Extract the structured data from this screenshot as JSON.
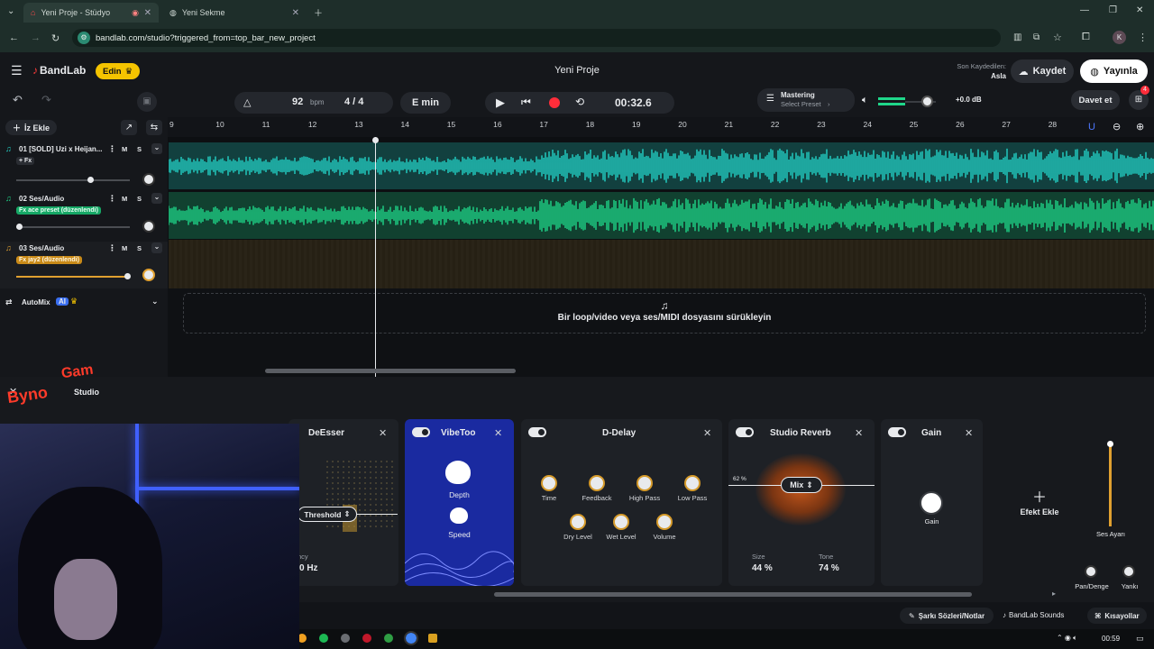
{
  "browser": {
    "tabs": [
      {
        "title": "Yeni Proje - Stüdyo",
        "active": true
      },
      {
        "title": "Yeni Sekme",
        "active": false
      }
    ],
    "url": "bandlab.com/studio?triggered_from=top_bar_new_project",
    "profile_initial": "K"
  },
  "topbar": {
    "brand": "BandLab",
    "edit_label": "Edin",
    "project_title": "Yeni Proje",
    "last_saved_label": "Son Kaydedilen:",
    "last_saved_value": "Asla",
    "save_label": "Kaydet",
    "publish_label": "Yayınla"
  },
  "transport": {
    "bpm_value": "92",
    "bpm_unit": "bpm",
    "time_signature": "4 / 4",
    "key": "E min",
    "time": "00:32.6",
    "mastering_title": "Mastering",
    "mastering_sub": "Select Preset",
    "volume_db": "+0.0 dB",
    "invite_label": "Davet et",
    "notification_count": "4",
    "master_volume": 0.7
  },
  "ruler": {
    "bars": [
      "9",
      "10",
      "11",
      "12",
      "13",
      "14",
      "15",
      "16",
      "17",
      "18",
      "19",
      "20",
      "21",
      "22",
      "23",
      "24",
      "25",
      "26",
      "27",
      "28"
    ]
  },
  "sidebar": {
    "add_track_label": "İz Ekle",
    "automix_label": "AutoMix",
    "automix_badge": "AI"
  },
  "tracks": [
    {
      "name": "01 [SOLD] Uzi x Heijan...",
      "fx": "+ Fx",
      "mute": "M",
      "solo": "S",
      "volume": 0.65,
      "color": "#23d3c8"
    },
    {
      "name": "02 Ses/Audio",
      "fx": "Fx ace preset (düzenlendi)",
      "mute": "M",
      "solo": "S",
      "volume": 0.02,
      "color": "#1fd78a"
    },
    {
      "name": "03 Ses/Audio",
      "fx": "Fx jay2 (düzenlendi)",
      "mute": "M",
      "solo": "S",
      "volume": 0.98,
      "color": "#e0a030"
    }
  ],
  "dropzone": {
    "text": "Bir loop/video veya ses/MIDI dosyasını sürükleyin"
  },
  "effects": {
    "panel_title": "Studio",
    "deesser": {
      "title": "DeEsser",
      "threshold_label": "Threshold",
      "freq_label": "ncy",
      "freq_value": "0 Hz"
    },
    "vibetoo": {
      "title": "VibeToo",
      "depth": "Depth",
      "speed": "Speed"
    },
    "ddelay": {
      "title": "D-Delay",
      "knobs": [
        "Time",
        "Feedback",
        "High Pass",
        "Low Pass",
        "Dry Level",
        "Wet Level",
        "Volume"
      ]
    },
    "reverb": {
      "title": "Studio Reverb",
      "mix_label": "Mix",
      "mix_value": "62 %",
      "size_label": "Size",
      "size_value": "44 %",
      "tone_label": "Tone",
      "tone_value": "74 %"
    },
    "gain": {
      "title": "Gain",
      "knob_label": "Gain"
    },
    "add_effect": "Efekt Ekle",
    "master": {
      "volume_label": "Ses Ayarı",
      "pan_label": "Pan/Denge",
      "echo_label": "Yankı"
    }
  },
  "bottombar": {
    "lyrics": "Şarkı Sözleri/Notlar",
    "sounds": "BandLab Sounds",
    "shortcuts": "Kısayollar"
  },
  "taskbar": {
    "time": "00:59"
  },
  "colors": {
    "accent_yellow": "#f5c400",
    "record_red": "#ff2d3a",
    "track1": "#23d3c8",
    "track2": "#1fd78a",
    "track3": "#e0a030",
    "vibe_blue": "#1a2aa0",
    "reverb_glow": "#c2561b"
  }
}
